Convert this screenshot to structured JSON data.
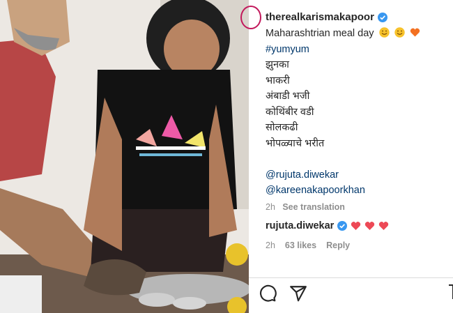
{
  "post": {
    "username": "therealkarismakapoor",
    "caption_title": "Maharashtrian meal day",
    "hashtag": "#yumyum",
    "dishes": [
      "झुनका",
      "भाकरी",
      "अंबाडी भजी",
      "कोथिंबीर वडी",
      "सोलकढी",
      "भोपळ्याचे भरीत"
    ],
    "mentions": [
      "@rujuta.diwekar",
      "@kareenakapoorkhan"
    ],
    "time": "2h",
    "see_translation": "See translation"
  },
  "comment": {
    "username": "rujuta.diwekar",
    "time": "2h",
    "likes": "63 likes",
    "reply": "Reply"
  },
  "colors": {
    "verified": "#3897f0",
    "heart": "#ed4956",
    "emoji_face": "#f7c22b",
    "emoji_heart": "#f37021"
  },
  "icons": [
    "comment-icon",
    "share-icon",
    "bookmark-icon",
    "verified-badge-icon",
    "heart-icon",
    "smile-emoji-icon"
  ]
}
